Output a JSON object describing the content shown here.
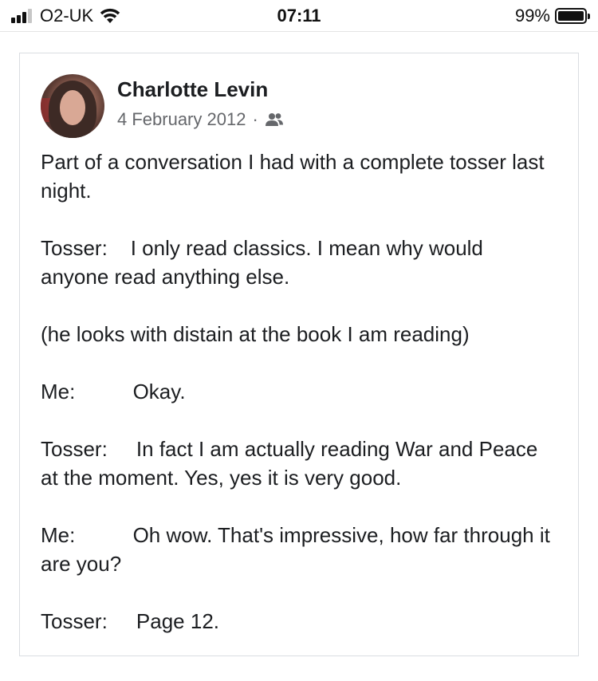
{
  "status_bar": {
    "carrier": "O2-UK",
    "time": "07:11",
    "battery": "99%",
    "battery_level": 0.99,
    "icons": [
      "signal-icon",
      "wifi-icon",
      "battery-icon"
    ]
  },
  "post": {
    "author": "Charlotte Levin",
    "date": "4 February 2012",
    "separator": "·",
    "audience_icon": "friends-icon",
    "paragraphs": [
      "Part of a conversation I had with a complete tosser last night.",
      "Tosser:    I only read classics. I mean why would anyone read anything else.",
      "(he looks with distain at the book I am reading)",
      "Me:          Okay.",
      "Tosser:     In fact I am actually reading War and Peace at the moment. Yes, yes it is very good.",
      "Me:          Oh wow. That's impressive, how far through it are you?",
      "Tosser:     Page 12."
    ]
  },
  "colors": {
    "text": "#1c1e21",
    "secondary_text": "#65676b",
    "card_border": "#dadde1"
  }
}
